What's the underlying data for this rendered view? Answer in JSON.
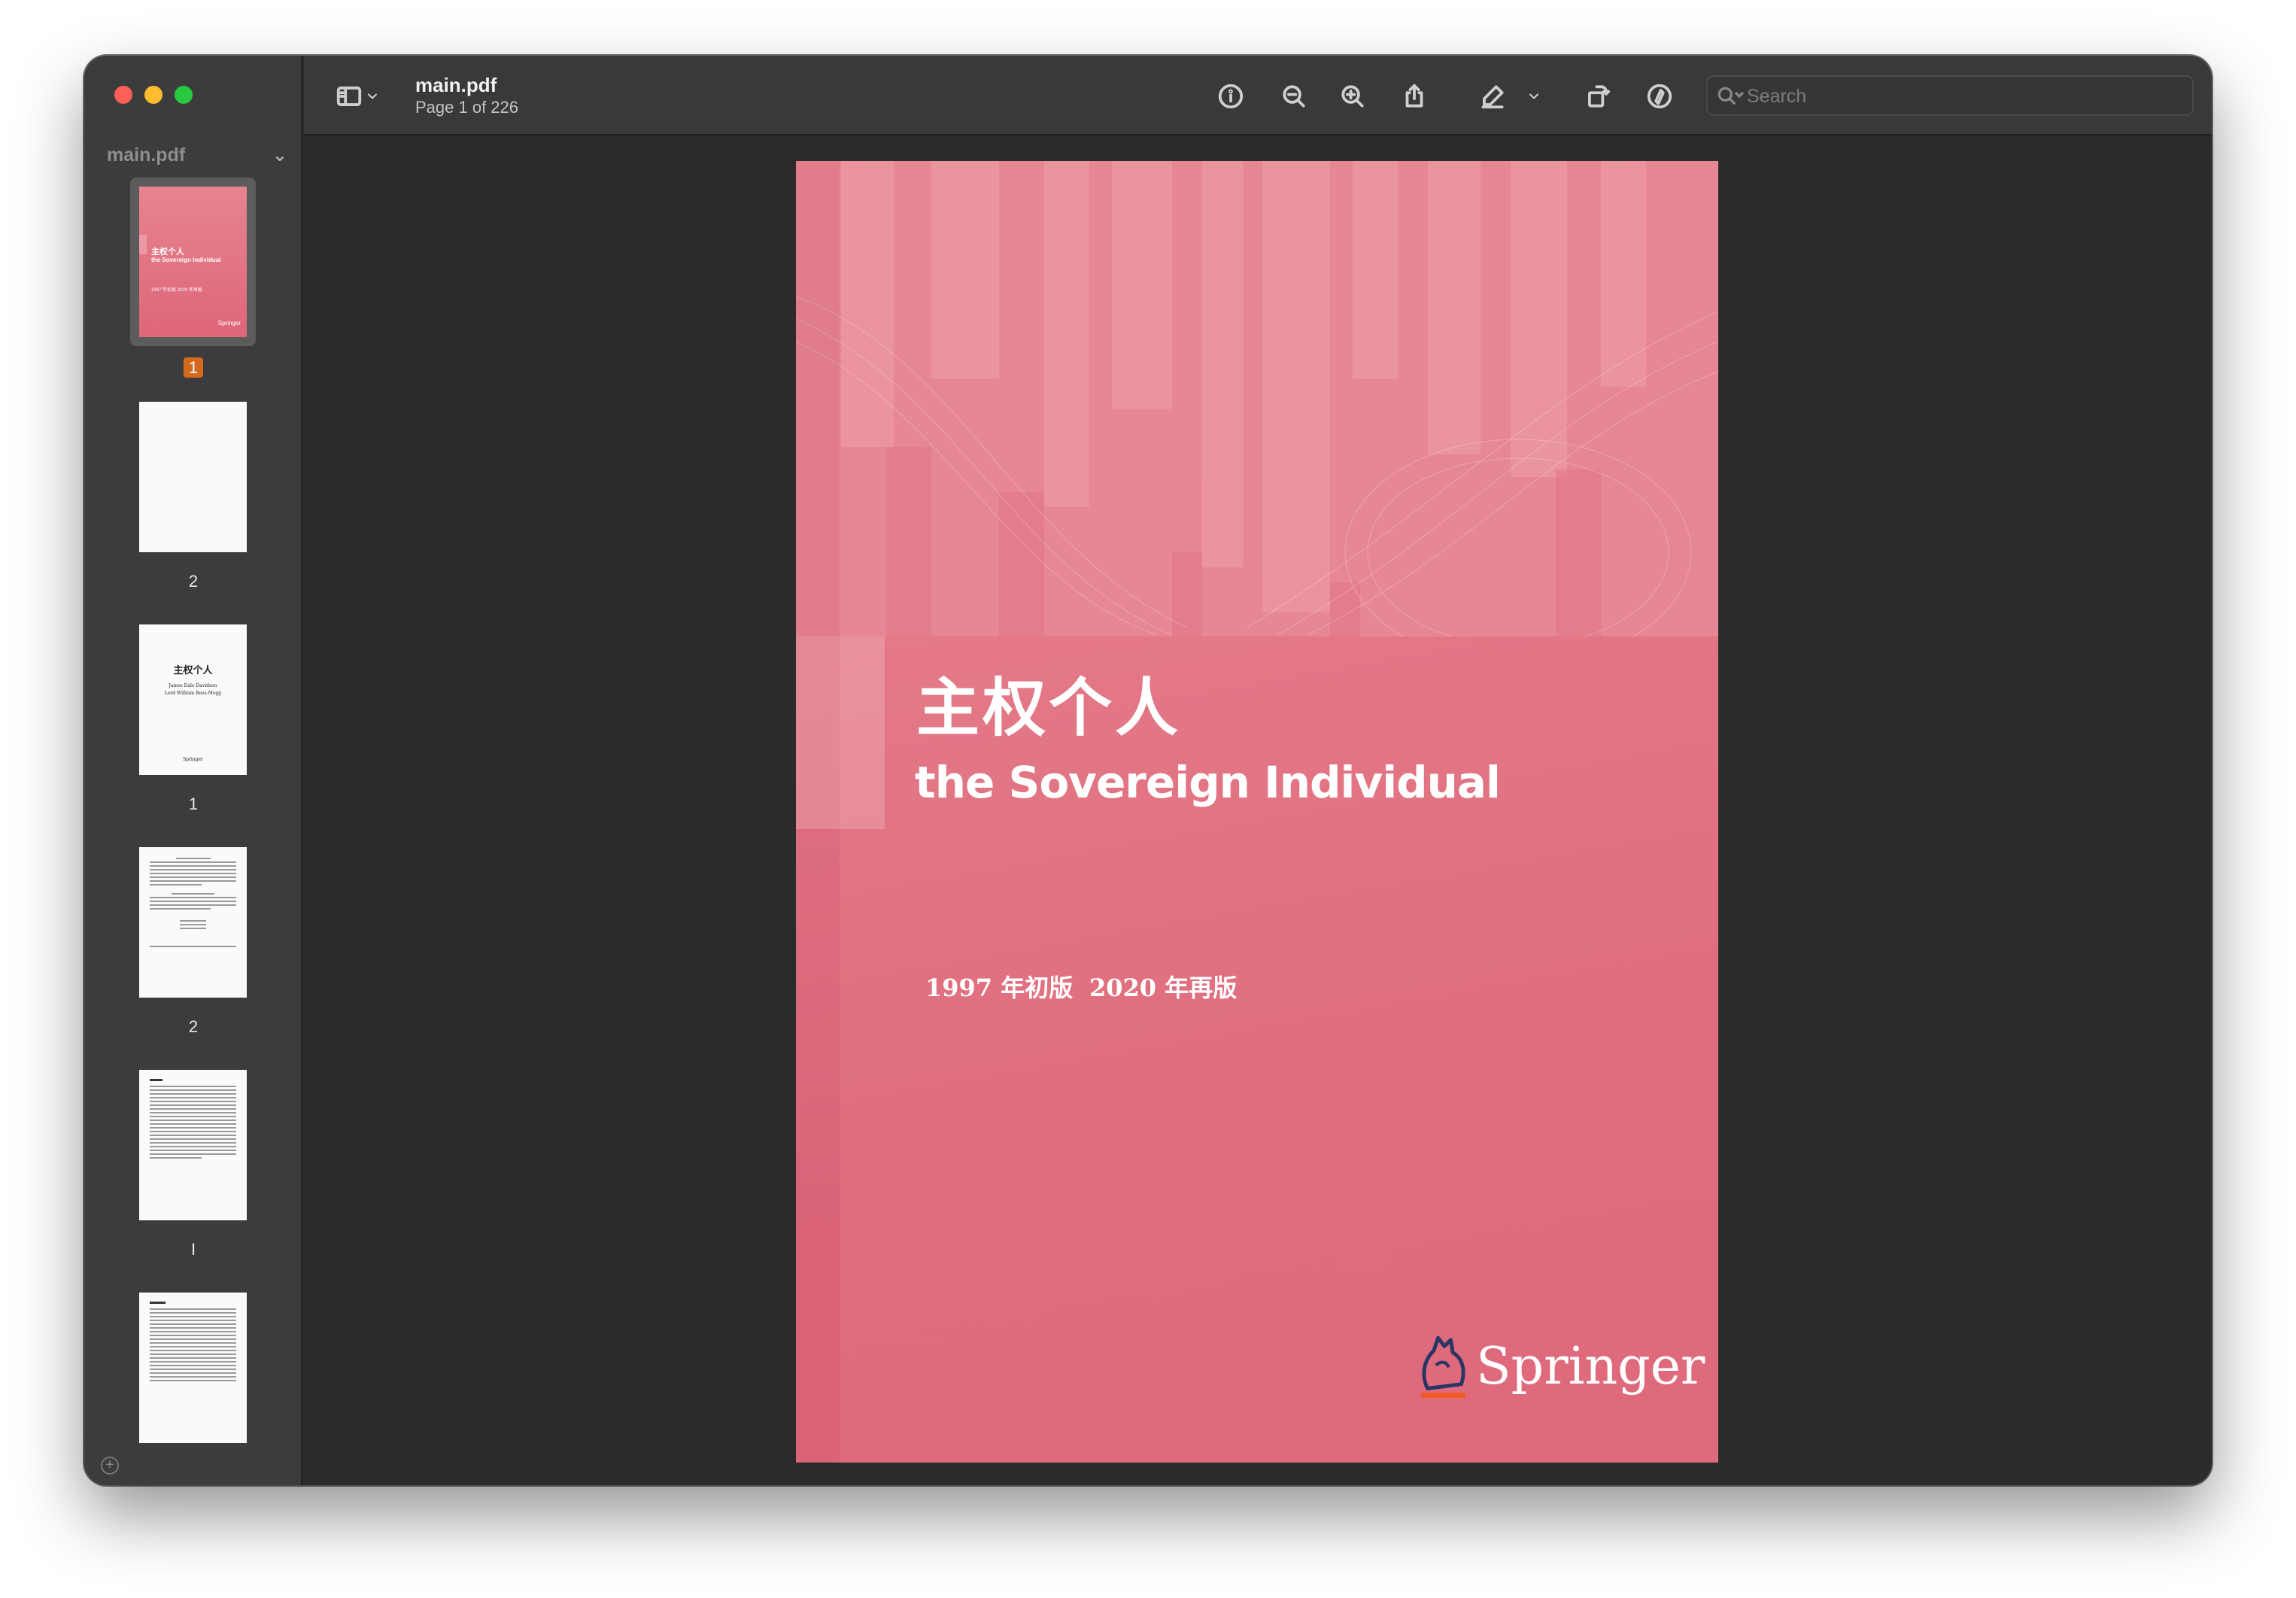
{
  "toolbar": {
    "doc_title": "main.pdf",
    "page_info": "Page 1 of 226",
    "search_placeholder": "Search",
    "icons": [
      "sidebar-toggle-icon",
      "chevron-down-icon",
      "info-icon",
      "zoom-out-icon",
      "zoom-in-icon",
      "share-icon",
      "highlight-pen-icon",
      "chevron-down-icon",
      "rotate-icon",
      "markup-icon",
      "signature-icon",
      "search-icon"
    ]
  },
  "sidebar": {
    "header": "main.pdf",
    "thumbnails": [
      {
        "label": "1",
        "kind": "cover",
        "selected": true,
        "mini_title": "主权个人",
        "mini_sub": "the Sovereign Individual",
        "mini_ed": "1997 年初版  2020 年再版",
        "mini_brand": "Springer"
      },
      {
        "label": "2",
        "kind": "blank"
      },
      {
        "label": "1",
        "kind": "title",
        "mini_title": "主权个人",
        "mini_lines": [
          "James Dale Davidson",
          "Lord William Rees-Mogg"
        ],
        "mini_brand": "Springer"
      },
      {
        "label": "2",
        "kind": "text"
      },
      {
        "label": "I",
        "kind": "text"
      },
      {
        "label": "",
        "kind": "text"
      }
    ]
  },
  "document": {
    "title_cn": "主权个人",
    "title_en": "the Sovereign Individual",
    "edition_first": "1997 年初版",
    "edition_second": "2020 年再版",
    "publisher": "Springer"
  },
  "colors": {
    "cover_pink": "#e37786",
    "springer_orange": "#f05a28",
    "selection_badge": "#d2691e",
    "traffic_red": "#fe5f57",
    "traffic_yellow": "#febc2e",
    "traffic_green": "#28c840"
  }
}
